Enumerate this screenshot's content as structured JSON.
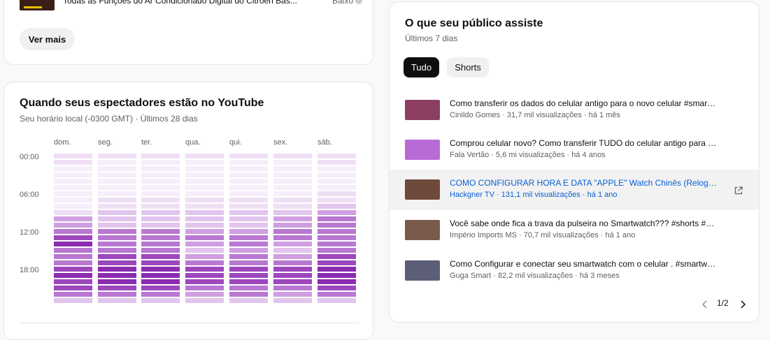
{
  "top_card": {
    "prev_video": {
      "title": "Todas as Funções do Ar Condicionado Digital do Citroën Bas...",
      "meta": "Baixo"
    },
    "see_more_label": "Ver mais"
  },
  "heatmap": {
    "title": "Quando seus espectadores estão no YouTube",
    "subtitle": "Seu horário local (-0300 GMT) · Últimos 28 dias",
    "days": [
      "dom.",
      "seg.",
      "ter.",
      "qua.",
      "qui.",
      "sex.",
      "sáb."
    ],
    "hours": [
      "00:00",
      "06:00",
      "12:00",
      "18:00"
    ],
    "palette": [
      "#f6eefa",
      "#efdff5",
      "#e2c5ed",
      "#cf9fe1",
      "#b878d2",
      "#9d47bd",
      "#8b2bb0"
    ],
    "levels": [
      [
        1,
        1,
        0,
        0,
        0,
        0,
        0,
        0,
        0,
        1,
        3,
        3,
        4,
        5,
        6,
        4,
        4,
        4,
        5,
        6,
        5,
        5,
        4,
        2
      ],
      [
        1,
        0,
        0,
        0,
        0,
        0,
        0,
        1,
        1,
        2,
        2,
        2,
        4,
        4,
        4,
        4,
        5,
        5,
        6,
        6,
        6,
        5,
        4,
        2
      ],
      [
        1,
        0,
        0,
        0,
        0,
        0,
        0,
        1,
        1,
        2,
        2,
        2,
        4,
        4,
        4,
        4,
        5,
        5,
        6,
        6,
        6,
        5,
        4,
        2
      ],
      [
        1,
        0,
        0,
        0,
        0,
        0,
        0,
        1,
        1,
        2,
        2,
        2,
        3,
        4,
        3,
        2,
        3,
        4,
        5,
        5,
        5,
        4,
        3,
        2
      ],
      [
        1,
        0,
        0,
        0,
        0,
        0,
        0,
        1,
        1,
        2,
        2,
        2,
        3,
        4,
        4,
        3,
        4,
        4,
        5,
        5,
        5,
        4,
        4,
        2
      ],
      [
        1,
        0,
        0,
        0,
        0,
        0,
        0,
        1,
        1,
        2,
        3,
        3,
        4,
        4,
        3,
        2,
        3,
        4,
        5,
        5,
        5,
        4,
        3,
        2
      ],
      [
        1,
        1,
        0,
        0,
        0,
        0,
        1,
        1,
        2,
        3,
        4,
        4,
        4,
        4,
        4,
        4,
        5,
        5,
        6,
        6,
        6,
        5,
        4,
        2
      ]
    ]
  },
  "audience": {
    "title": "O que seu público assiste",
    "subtitle": "Últimos 7 dias",
    "chips": [
      "Tudo",
      "Shorts"
    ],
    "videos": [
      {
        "title": "Como transferir os dados do celular antigo para o novo celular #smartphone",
        "meta": "Cinildo Gomes · 31,7 mil visualizações · há 1 mês",
        "thumb_color": "#8c3f63"
      },
      {
        "title": "Comprou celular novo? Como transferir TUDO do celular antigo para o novo",
        "meta": "Fala Vertão · 5,6 mi visualizações · há 4 anos",
        "thumb_color": "#b86bd6"
      },
      {
        "title": "COMO CONFIGURAR HORA E DATA \"APPLE\" Watch Chinês (Relogio Chinês)",
        "meta": "Hackgner TV · 131,1 mil visualizações · há 1 ano",
        "thumb_color": "#6e4a3c"
      },
      {
        "title": "Você sabe onde fica a trava da pulseira no Smartwatch??? #shorts #smartwatch",
        "meta": "Império Imports MS · 70,7 mil visualizações · há 1 ano",
        "thumb_color": "#7a5a4a"
      },
      {
        "title": "Como Configurar e conectar seu smartwatch com o celular . #smartwatch",
        "meta": "Guga Smart · 82,2 mil visualizações · há 3 meses",
        "thumb_color": "#5c5e78"
      }
    ],
    "page_indicator": "1/2"
  }
}
